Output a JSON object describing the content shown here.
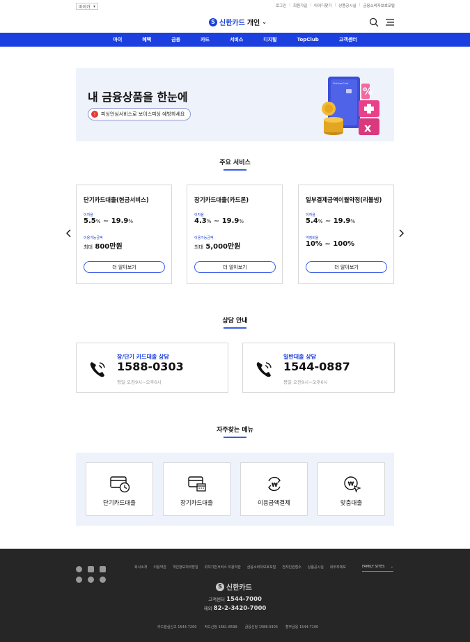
{
  "util": {
    "lang": "마이카",
    "links": [
      "로그인",
      "회원가입",
      "아이디찾기",
      "상품공시실",
      "금융소비자보호포털"
    ]
  },
  "header": {
    "brand": "신한카드",
    "segment": "개인"
  },
  "gnb": [
    "마이",
    "혜택",
    "금융",
    "카드",
    "서비스",
    "디지털",
    "TopClub",
    "고객센터"
  ],
  "banner": {
    "title": "내 금융상품을 한눈에",
    "pill": "피싱안심서비스로 보이스피싱 예방하세요",
    "card_text": "ShinhanCard"
  },
  "services": {
    "title": "주요 서비스",
    "cards": [
      {
        "name": "단기카드대출(현금서비스)",
        "rate_label": "이자율",
        "rate_from": "5.5",
        "rate_to": "19.9",
        "limit_label": "이용가능금액",
        "limit_prefix": "최대",
        "limit_value": "800만원",
        "button": "더 알아보기"
      },
      {
        "name": "장기카드대출(카드론)",
        "rate_label": "이자율",
        "rate_from": "4.3",
        "rate_to": "19.9",
        "limit_label": "이용가능금액",
        "limit_prefix": "최대",
        "limit_value": "5,000만원",
        "button": "더 알아보기"
      },
      {
        "name": "일부결제금액이월약정(리볼빙)",
        "rate_label": "이자율",
        "rate_from": "5.4",
        "rate_to": "19.9",
        "limit_label": "약정비율",
        "limit_value": "10% ~ 100%",
        "button": "더 알아보기"
      }
    ]
  },
  "consult": {
    "title": "상담 안내",
    "items": [
      {
        "title": "장/단기 카드대출 상담",
        "number": "1588-0303",
        "hours": "평일 오전9시~오후6시"
      },
      {
        "title": "일반대출 상담",
        "number": "1544-0887",
        "hours": "평일 오전9시~오후6시"
      }
    ]
  },
  "quick": {
    "title": "자주찾는 메뉴",
    "items": [
      "단기카드대출",
      "장기카드대출",
      "이용금액결제",
      "맞춤대출"
    ]
  },
  "footer": {
    "links": [
      "회사소개",
      "이용약관",
      "개인정보처리방침",
      "위치기반서비스 이용약관",
      "금융소비자보호포털",
      "전자민원접수",
      "상품공시실",
      "내부자제보"
    ],
    "family": "FAMILY SITES",
    "brand": "신한카드",
    "cs_label": "고객센터",
    "cs_number": "1544-7000",
    "abroad_label": "해외",
    "abroad_number": "82-2-3420-7000",
    "bottom": [
      "카드분실신고 1544-7200",
      "카드신청 1661-8599",
      "금융신청 1588-0303",
      "할부금융 1544-7100"
    ]
  }
}
